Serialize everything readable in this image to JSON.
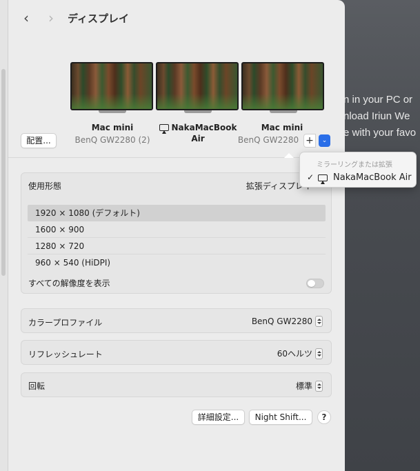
{
  "window": {
    "title": "ディスプレイ",
    "back_glyph": "‹",
    "forward_glyph": "›"
  },
  "monitors": [
    {
      "name": "Mac mini",
      "subtitle": "BenQ GW2280 (2)",
      "icon": "display-icon"
    },
    {
      "name_line1": "NakaMacBook",
      "name_line2": "Air",
      "icon": "airplay-icon"
    },
    {
      "name": "Mac mini",
      "subtitle": "BenQ GW2280",
      "icon": "display-icon"
    }
  ],
  "controls": {
    "arrange_label": "配置...",
    "add_label": "+",
    "add_menu_glyph": "⌄"
  },
  "popup": {
    "heading": "ミラーリングまたは拡張",
    "check_glyph": "✓",
    "item_label": "NakaMacBook Air"
  },
  "usage": {
    "label": "使用形態",
    "value": "拡張ディスプレイ"
  },
  "resolutions": {
    "items": [
      "1920 × 1080 (デフォルト)",
      "1600 × 900",
      "1280 × 720",
      "960 × 540 (HiDPI)"
    ],
    "selected_index": 0,
    "show_all_label": "すべての解像度を表示",
    "show_all_on": false
  },
  "color_profile": {
    "label": "カラープロファイル",
    "value": "BenQ GW2280"
  },
  "refresh_rate": {
    "label": "リフレッシュレート",
    "value": "60ヘルツ"
  },
  "rotation": {
    "label": "回転",
    "value": "標準"
  },
  "footer": {
    "advanced_label": "詳細設定...",
    "night_shift_label": "Night Shift...",
    "help_label": "?"
  },
  "background_text": {
    "line1": "n in your PC or",
    "line2": "nload Iriun We",
    "line3": "e with your favo",
    "chevron": "⟩"
  },
  "colors": {
    "accent": "#2a6ee8",
    "window_bg": "#ececec",
    "group_bg": "#e6e6e6"
  }
}
